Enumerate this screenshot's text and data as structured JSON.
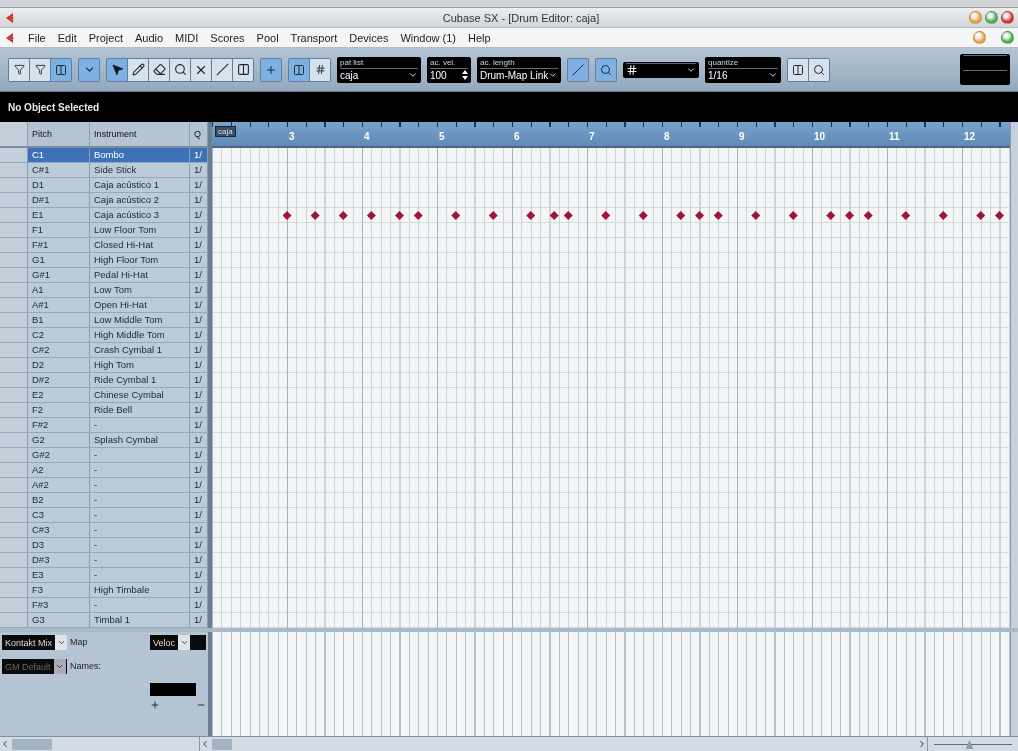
{
  "window": {
    "title": "Cubase SX - [Drum Editor: caja]"
  },
  "menu": [
    "File",
    "Edit",
    "Project",
    "Audio",
    "MIDI",
    "Scores",
    "Pool",
    "Transport",
    "Devices",
    "Window (1)",
    "Help"
  ],
  "tools": [
    {
      "kind": "select",
      "selected": true
    },
    {
      "kind": "draw",
      "selected": false
    },
    {
      "kind": "erase",
      "selected": false
    },
    {
      "kind": "zoom",
      "selected": false
    },
    {
      "kind": "mute",
      "selected": false
    },
    {
      "kind": "line",
      "selected": false
    },
    {
      "kind": "glue",
      "selected": false
    }
  ],
  "fields": [
    {
      "label": "pat list",
      "value": "caja",
      "kind": "dropdown"
    },
    {
      "label": "ac. vel.",
      "value": "100",
      "kind": "spin"
    },
    {
      "label": "ac. length",
      "value": "Drum-Map Link",
      "kind": "dropdown"
    }
  ],
  "quantize": {
    "label": "quantize",
    "value": "1/16"
  },
  "info_line": "No Object Selected",
  "columns": [
    "Pitch",
    "Instrument",
    "Q"
  ],
  "part_label": "caja",
  "ruler": [
    "3",
    "4",
    "5",
    "6",
    "7",
    "8",
    "9",
    "10",
    "11",
    "12"
  ],
  "rows": [
    {
      "pitch": "C1",
      "instrument": "Bombo",
      "quantize": "1/",
      "selected": true
    },
    {
      "pitch": "C#1",
      "instrument": "Side Stick",
      "quantize": "1/",
      "selected": false
    },
    {
      "pitch": "D1",
      "instrument": "Caja acústico 1",
      "quantize": "1/",
      "selected": false
    },
    {
      "pitch": "D#1",
      "instrument": "Caja acústico 2",
      "quantize": "1/",
      "selected": false
    },
    {
      "pitch": "E1",
      "instrument": "Caja acústico 3",
      "quantize": "1/",
      "selected": false,
      "steps": [
        false,
        false,
        false,
        false,
        false,
        false,
        false,
        false,
        false,
        false,
        false,
        false,
        false,
        false,
        false,
        false,
        true,
        false,
        false,
        false,
        false,
        false,
        true,
        false,
        false,
        false,
        false,
        false,
        true,
        false,
        false,
        false,
        false,
        false,
        true,
        false,
        false,
        false,
        false,
        false,
        true,
        false,
        false,
        false,
        true,
        false,
        false,
        false,
        false,
        false,
        false,
        false,
        true,
        false,
        false,
        false,
        false,
        false,
        false,
        false,
        true,
        false,
        false,
        false,
        false,
        false,
        false,
        false,
        true,
        false,
        false,
        false,
        false,
        true,
        false,
        false,
        true,
        false,
        false,
        false,
        false,
        false,
        false,
        false,
        true,
        false,
        false,
        false,
        false,
        false,
        false,
        false,
        true,
        false,
        false,
        false,
        false,
        false,
        false,
        false,
        true,
        false,
        false,
        false,
        true,
        false,
        false,
        false,
        true,
        false,
        false,
        false,
        false,
        false,
        false,
        false,
        true,
        false,
        false,
        false,
        false,
        false,
        false,
        false,
        true,
        false,
        false,
        false,
        false,
        false,
        false,
        false,
        true,
        false,
        false,
        false,
        true,
        false,
        false,
        false,
        true,
        false,
        false,
        false,
        false,
        false,
        false,
        false,
        true,
        false,
        false,
        false,
        false,
        false,
        false,
        false,
        true,
        false,
        false,
        false,
        false,
        false,
        false,
        false,
        true,
        false,
        false,
        false,
        true,
        false
      ]
    },
    {
      "pitch": "F1",
      "instrument": "Low Floor Tom",
      "quantize": "1/",
      "selected": false
    },
    {
      "pitch": "F#1",
      "instrument": "Closed Hi-Hat",
      "quantize": "1/",
      "selected": false
    },
    {
      "pitch": "G1",
      "instrument": "High Floor Tom",
      "quantize": "1/",
      "selected": false
    },
    {
      "pitch": "G#1",
      "instrument": "Pedal Hi-Hat",
      "quantize": "1/",
      "selected": false
    },
    {
      "pitch": "A1",
      "instrument": "Low Tom",
      "quantize": "1/",
      "selected": false
    },
    {
      "pitch": "A#1",
      "instrument": "Open Hi-Hat",
      "quantize": "1/",
      "selected": false
    },
    {
      "pitch": "B1",
      "instrument": "Low Middle Tom",
      "quantize": "1/",
      "selected": false
    },
    {
      "pitch": "C2",
      "instrument": "High Middle Tom",
      "quantize": "1/",
      "selected": false
    },
    {
      "pitch": "C#2",
      "instrument": "Crash Cymbal 1",
      "quantize": "1/",
      "selected": false
    },
    {
      "pitch": "D2",
      "instrument": "High Tom",
      "quantize": "1/",
      "selected": false
    },
    {
      "pitch": "D#2",
      "instrument": "Ride Cymbal 1",
      "quantize": "1/",
      "selected": false
    },
    {
      "pitch": "E2",
      "instrument": "Chinese Cymbal",
      "quantize": "1/",
      "selected": false
    },
    {
      "pitch": "F2",
      "instrument": "Ride Bell",
      "quantize": "1/",
      "selected": false
    },
    {
      "pitch": "F#2",
      "instrument": "-",
      "quantize": "1/",
      "selected": false
    },
    {
      "pitch": "G2",
      "instrument": "Splash Cymbal",
      "quantize": "1/",
      "selected": false
    },
    {
      "pitch": "G#2",
      "instrument": "-",
      "quantize": "1/",
      "selected": false
    },
    {
      "pitch": "A2",
      "instrument": "-",
      "quantize": "1/",
      "selected": false
    },
    {
      "pitch": "A#2",
      "instrument": "-",
      "quantize": "1/",
      "selected": false
    },
    {
      "pitch": "B2",
      "instrument": "-",
      "quantize": "1/",
      "selected": false
    },
    {
      "pitch": "C3",
      "instrument": "-",
      "quantize": "1/",
      "selected": false
    },
    {
      "pitch": "C#3",
      "instrument": "-",
      "quantize": "1/",
      "selected": false
    },
    {
      "pitch": "D3",
      "instrument": "-",
      "quantize": "1/",
      "selected": false
    },
    {
      "pitch": "D#3",
      "instrument": "-",
      "quantize": "1/",
      "selected": false
    },
    {
      "pitch": "E3",
      "instrument": "-",
      "quantize": "1/",
      "selected": false
    },
    {
      "pitch": "F3",
      "instrument": "High Timbale",
      "quantize": "1/",
      "selected": false
    },
    {
      "pitch": "F#3",
      "instrument": "-",
      "quantize": "1/",
      "selected": false
    },
    {
      "pitch": "G3",
      "instrument": "Timbal 1",
      "quantize": "1/",
      "selected": false
    }
  ],
  "map_panel": {
    "map_select": "Kontakt Mix",
    "map_label": "Map",
    "lane_select": "Veloc",
    "names_select": "GM Default",
    "names_label": "Names:"
  },
  "zoom_slider": {
    "level": 0.45
  }
}
